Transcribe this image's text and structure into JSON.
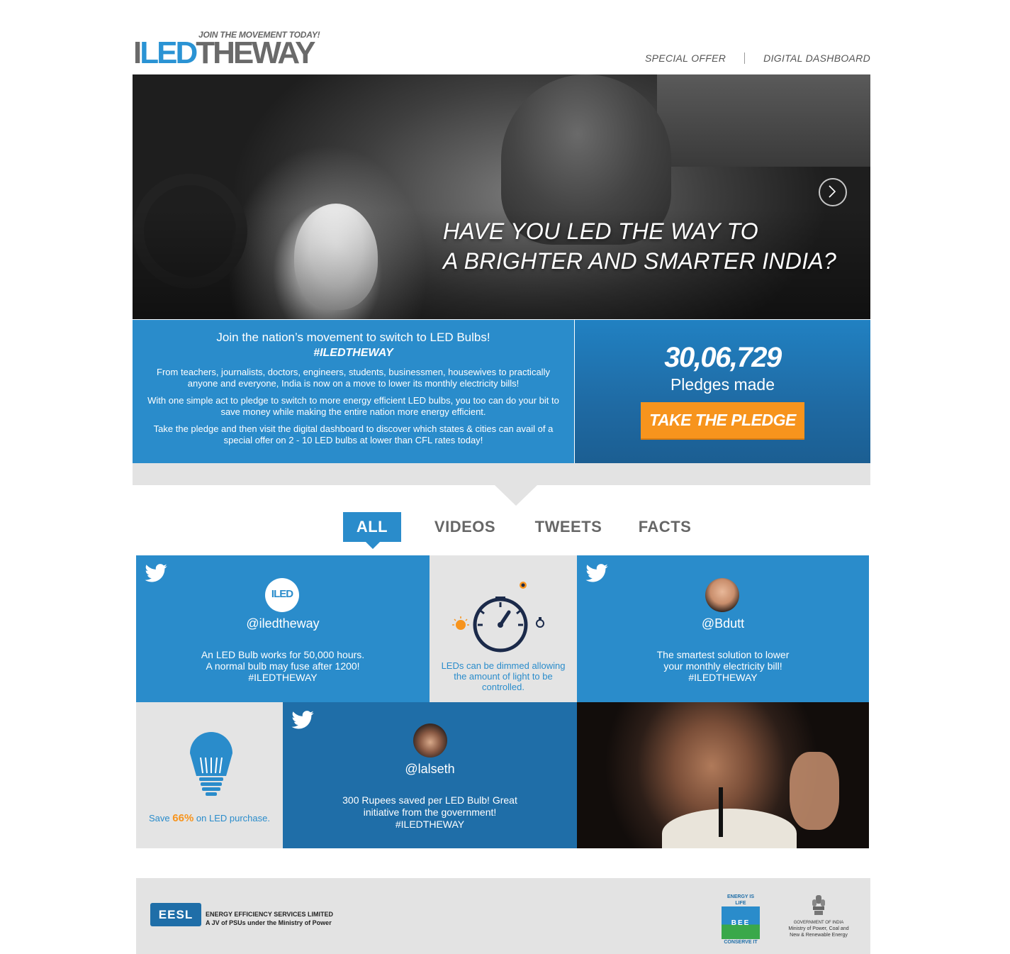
{
  "header": {
    "tagline": "JOIN THE MOVEMENT TODAY!",
    "logo": {
      "part_i": "I",
      "part_led": "LED",
      "part_theway": "THEWAY"
    },
    "nav": [
      {
        "label": "SPECIAL OFFER"
      },
      {
        "label": "DIGITAL DASHBOARD"
      }
    ]
  },
  "hero": {
    "title_line1": "HAVE YOU LED THE WAY TO",
    "title_line2": "A BRIGHTER AND SMARTER INDIA?",
    "next_icon": "chevron-right-icon"
  },
  "info": {
    "heading": "Join the nation’s movement to switch to LED Bulbs!",
    "hashtag": "#ILEDTHEWAY",
    "paragraphs": [
      "From teachers, journalists, doctors, engineers, students, businessmen, housewives to practically anyone and everyone, India is now on a move to lower its monthly electricity bills!",
      "With one simple act to pledge to switch to more energy efficient LED bulbs, you too can do your bit to save money while making the entire nation more energy efficient.",
      "Take the pledge and then visit the digital dashboard to discover which states & cities can avail of a special offer on 2 - 10 LED bulbs at lower than CFL rates today!"
    ],
    "pledge_count": "30,06,729",
    "pledge_label": "Pledges made",
    "pledge_button": "TAKE THE PLEDGE"
  },
  "tabs": [
    {
      "label": "ALL",
      "active": true
    },
    {
      "label": "VIDEOS",
      "active": false
    },
    {
      "label": "TWEETS",
      "active": false
    },
    {
      "label": "FACTS",
      "active": false
    }
  ],
  "grid": {
    "tweet1": {
      "avatar_text": "ILED",
      "handle": "@iledtheway",
      "line1": "An LED Bulb works for 50,000 hours.",
      "line2": "A normal bulb may fuse after 1200!",
      "line3": "#ILEDTHEWAY"
    },
    "fact1": {
      "icon": "dimmer-gauge-icon",
      "text": "LEDs can be dimmed allowing the amount of light to be controlled."
    },
    "tweet2": {
      "handle": "@Bdutt",
      "line1": "The smartest solution to lower",
      "line2": "your monthly electricity bill!",
      "line3": "#ILEDTHEWAY"
    },
    "fact2": {
      "icon": "led-bulb-icon",
      "prefix": "Save",
      "highlight": "66%",
      "suffix": "on LED purchase."
    },
    "tweet3": {
      "handle": "@lalseth",
      "line1": "300 Rupees saved per LED Bulb! Great",
      "line2": "initiative from the government!",
      "line3": "#ILEDTHEWAY"
    }
  },
  "footer": {
    "eesl_logo": "EESL",
    "eesl_name": "ENERGY EFFICIENCY SERVICES LIMITED",
    "eesl_sub": "A JV of PSUs under the Ministry of Power",
    "bee_top": "ENERGY IS LIFE",
    "bee_mid": "BEE",
    "bee_bottom": "CONSERVE IT",
    "goi_line1": "GOVERNMENT OF INDIA",
    "goi_line2": "Ministry of Power, Coal and",
    "goi_line3": "New & Renewable Energy"
  },
  "colors": {
    "brand_blue": "#2a8ccb",
    "dark_blue": "#1f6ea8",
    "accent_orange": "#f7941d",
    "tile_grey": "#e4e4e4"
  }
}
